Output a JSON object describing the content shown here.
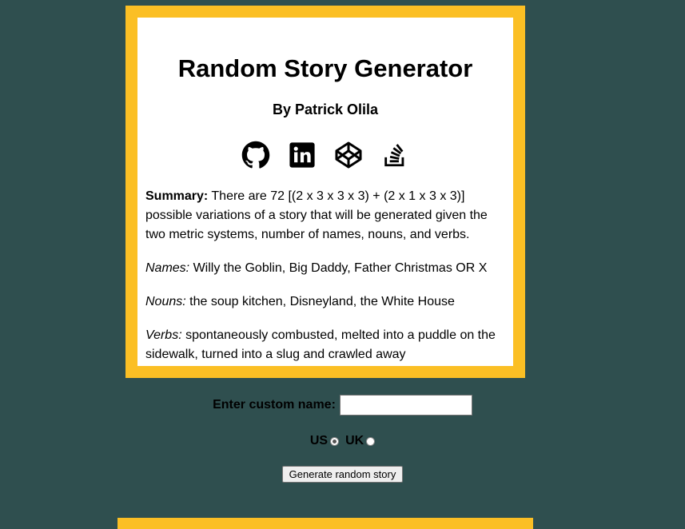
{
  "header": {
    "title": "Random Story Generator",
    "author": "By Patrick Olila"
  },
  "socials": [
    {
      "icon": "github-icon"
    },
    {
      "icon": "linkedin-icon"
    },
    {
      "icon": "codepen-icon"
    },
    {
      "icon": "stackoverflow-icon"
    }
  ],
  "summary": {
    "label": "Summary:",
    "text": " There are 72 [(2 x 3 x 3 x 3) + (2 x 1 x 3 x 3)] possible variations of a story that will be generated given the two metric systems, number of names, nouns, and verbs."
  },
  "names": {
    "label": "Names:",
    "text": " Willy the Goblin, Big Daddy, Father Christmas OR X"
  },
  "nouns": {
    "label": "Nouns:",
    "text": " the soup kitchen, Disneyland, the White House"
  },
  "verbs": {
    "label": "Verbs:",
    "text": " spontaneously combusted, melted into a puddle on the sidewalk, turned into a slug and crawled away"
  },
  "form": {
    "custom_name_label": "Enter custom name:",
    "custom_name_value": "",
    "us_label": "US",
    "uk_label": "UK",
    "selected_unit": "US",
    "generate_label": "Generate random story"
  },
  "colors": {
    "background": "#2f4f4f",
    "accent": "#fbbf24"
  }
}
